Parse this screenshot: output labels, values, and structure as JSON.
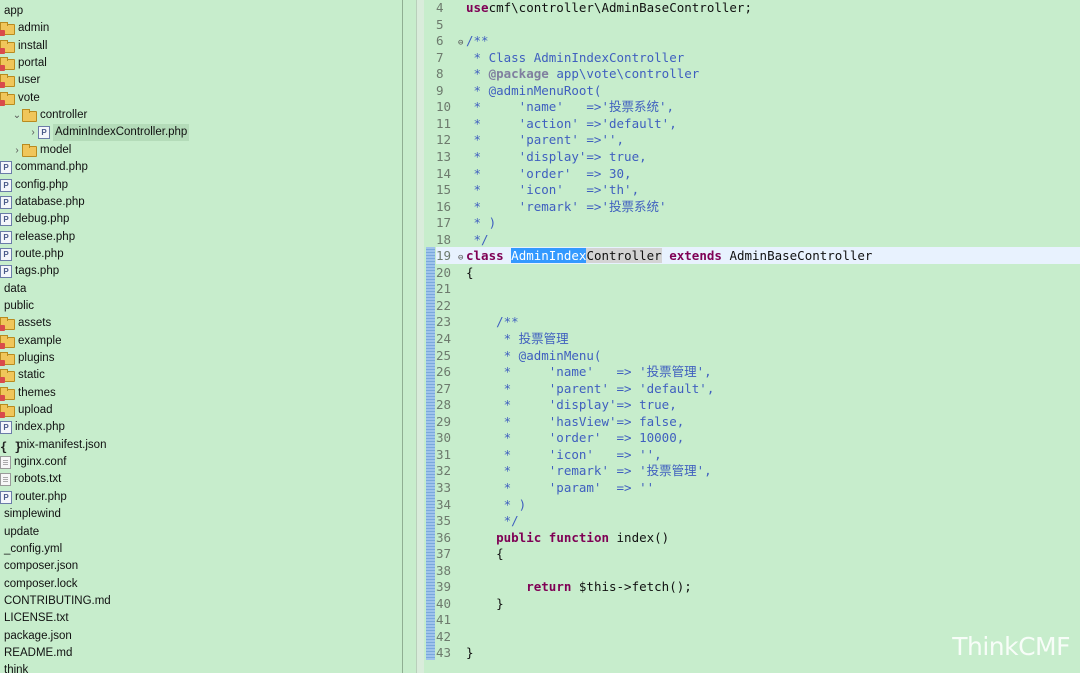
{
  "tree": [
    {
      "label": "app",
      "indent": 0,
      "icon": "none",
      "arrow": ""
    },
    {
      "label": "admin",
      "indent": 1,
      "icon": "package-folder-icon",
      "arrow": ""
    },
    {
      "label": "install",
      "indent": 1,
      "icon": "package-folder-icon",
      "arrow": ""
    },
    {
      "label": "portal",
      "indent": 1,
      "icon": "package-folder-icon",
      "arrow": ""
    },
    {
      "label": "user",
      "indent": 1,
      "icon": "package-folder-icon",
      "arrow": ""
    },
    {
      "label": "vote",
      "indent": 1,
      "icon": "package-folder-icon",
      "arrow": ""
    },
    {
      "label": "controller",
      "indent": 2,
      "icon": "folder-icon",
      "arrow": "v"
    },
    {
      "label": "AdminIndexController.php",
      "indent": 3,
      "icon": "php-file-icon",
      "arrow": ">",
      "selected": true
    },
    {
      "label": "model",
      "indent": 2,
      "icon": "folder-icon",
      "arrow": ">"
    },
    {
      "label": "command.php",
      "indent": 1,
      "icon": "php-file-icon",
      "arrow": ""
    },
    {
      "label": "config.php",
      "indent": 1,
      "icon": "php-file-icon",
      "arrow": ""
    },
    {
      "label": "database.php",
      "indent": 1,
      "icon": "php-file-icon",
      "arrow": ""
    },
    {
      "label": "debug.php",
      "indent": 1,
      "icon": "php-file-icon",
      "arrow": ""
    },
    {
      "label": "release.php",
      "indent": 1,
      "icon": "php-file-icon",
      "arrow": ""
    },
    {
      "label": "route.php",
      "indent": 1,
      "icon": "php-file-icon",
      "arrow": ""
    },
    {
      "label": "tags.php",
      "indent": 1,
      "icon": "php-file-icon",
      "arrow": ""
    },
    {
      "label": "data",
      "indent": 0,
      "icon": "none",
      "arrow": ""
    },
    {
      "label": "public",
      "indent": 0,
      "icon": "none",
      "arrow": ""
    },
    {
      "label": "assets",
      "indent": 1,
      "icon": "package-folder-icon",
      "arrow": ""
    },
    {
      "label": "example",
      "indent": 1,
      "icon": "package-folder-icon",
      "arrow": ""
    },
    {
      "label": "plugins",
      "indent": 1,
      "icon": "package-folder-icon",
      "arrow": ""
    },
    {
      "label": "static",
      "indent": 1,
      "icon": "package-folder-icon",
      "arrow": ""
    },
    {
      "label": "themes",
      "indent": 1,
      "icon": "package-folder-icon",
      "arrow": ""
    },
    {
      "label": "upload",
      "indent": 1,
      "icon": "package-folder-icon",
      "arrow": ""
    },
    {
      "label": "index.php",
      "indent": 1,
      "icon": "php-file-icon",
      "arrow": ""
    },
    {
      "label": "mix-manifest.json",
      "indent": 1,
      "icon": "json-file-icon",
      "arrow": ""
    },
    {
      "label": "nginx.conf",
      "indent": 1,
      "icon": "text-file-icon",
      "arrow": ""
    },
    {
      "label": "robots.txt",
      "indent": 1,
      "icon": "text-file-icon",
      "arrow": ""
    },
    {
      "label": "router.php",
      "indent": 1,
      "icon": "php-file-icon",
      "arrow": ""
    },
    {
      "label": "simplewind",
      "indent": 0,
      "icon": "none",
      "arrow": ""
    },
    {
      "label": "update",
      "indent": 0,
      "icon": "none",
      "arrow": ""
    },
    {
      "label": "_config.yml",
      "indent": 0,
      "icon": "none",
      "arrow": ""
    },
    {
      "label": "composer.json",
      "indent": 0,
      "icon": "none",
      "arrow": ""
    },
    {
      "label": "composer.lock",
      "indent": 0,
      "icon": "none",
      "arrow": ""
    },
    {
      "label": "CONTRIBUTING.md",
      "indent": 0,
      "icon": "none",
      "arrow": ""
    },
    {
      "label": "LICENSE.txt",
      "indent": 0,
      "icon": "none",
      "arrow": ""
    },
    {
      "label": "package.json",
      "indent": 0,
      "icon": "none",
      "arrow": ""
    },
    {
      "label": "README.md",
      "indent": 0,
      "icon": "none",
      "arrow": ""
    },
    {
      "label": "think",
      "indent": 0,
      "icon": "none",
      "arrow": ""
    }
  ],
  "code": [
    {
      "n": "4",
      "fold": "",
      "tokens": [
        [
          "k",
          "use"
        ],
        [
          "",
          "cmf\\controller\\AdminBaseController;"
        ]
      ]
    },
    {
      "n": "5",
      "fold": "",
      "tokens": []
    },
    {
      "n": "6",
      "fold": "⊖",
      "tokens": [
        [
          "c",
          "/**"
        ]
      ]
    },
    {
      "n": "7",
      "fold": "",
      "tokens": [
        [
          "c",
          " * Class AdminIndexController"
        ]
      ]
    },
    {
      "n": "8",
      "fold": "",
      "tokens": [
        [
          "c",
          " * "
        ],
        [
          "t",
          "@package"
        ],
        [
          "c",
          " app\\vote\\controller"
        ]
      ]
    },
    {
      "n": "9",
      "fold": "",
      "tokens": [
        [
          "c",
          " * @adminMenuRoot("
        ]
      ]
    },
    {
      "n": "10",
      "fold": "",
      "tokens": [
        [
          "c",
          " *     'name'   =>'投票系统',"
        ]
      ]
    },
    {
      "n": "11",
      "fold": "",
      "tokens": [
        [
          "c",
          " *     'action' =>'default',"
        ]
      ]
    },
    {
      "n": "12",
      "fold": "",
      "tokens": [
        [
          "c",
          " *     'parent' =>'',"
        ]
      ]
    },
    {
      "n": "13",
      "fold": "",
      "tokens": [
        [
          "c",
          " *     'display'=> true,"
        ]
      ]
    },
    {
      "n": "14",
      "fold": "",
      "tokens": [
        [
          "c",
          " *     'order'  => 30,"
        ]
      ]
    },
    {
      "n": "15",
      "fold": "",
      "tokens": [
        [
          "c",
          " *     'icon'   =>'th',"
        ]
      ]
    },
    {
      "n": "16",
      "fold": "",
      "tokens": [
        [
          "c",
          " *     'remark' =>'投票系统'"
        ]
      ]
    },
    {
      "n": "17",
      "fold": "",
      "tokens": [
        [
          "c",
          " * )"
        ]
      ]
    },
    {
      "n": "18",
      "fold": "",
      "tokens": [
        [
          "c",
          " */"
        ]
      ]
    },
    {
      "n": "19",
      "fold": "⊖",
      "current": true,
      "tokens": [
        [
          "k",
          "class"
        ],
        [
          "",
          " "
        ],
        [
          "hl",
          "AdminIndex"
        ],
        [
          "hl2",
          "Controller"
        ],
        [
          "",
          " "
        ],
        [
          "k",
          "extends"
        ],
        [
          "",
          " AdminBaseController"
        ]
      ]
    },
    {
      "n": "20",
      "fold": "",
      "tokens": [
        [
          "",
          "{"
        ]
      ]
    },
    {
      "n": "21",
      "fold": "",
      "tokens": []
    },
    {
      "n": "22",
      "fold": "",
      "tokens": []
    },
    {
      "n": "23",
      "fold": "",
      "tokens": [
        [
          "c",
          "    /**"
        ]
      ]
    },
    {
      "n": "24",
      "fold": "",
      "tokens": [
        [
          "c",
          "     * 投票管理"
        ]
      ]
    },
    {
      "n": "25",
      "fold": "",
      "tokens": [
        [
          "c",
          "     * @adminMenu("
        ]
      ]
    },
    {
      "n": "26",
      "fold": "",
      "tokens": [
        [
          "c",
          "     *     'name'   => '投票管理',"
        ]
      ]
    },
    {
      "n": "27",
      "fold": "",
      "tokens": [
        [
          "c",
          "     *     'parent' => 'default',"
        ]
      ]
    },
    {
      "n": "28",
      "fold": "",
      "tokens": [
        [
          "c",
          "     *     'display'=> true,"
        ]
      ]
    },
    {
      "n": "29",
      "fold": "",
      "tokens": [
        [
          "c",
          "     *     'hasView'=> false,"
        ]
      ]
    },
    {
      "n": "30",
      "fold": "",
      "tokens": [
        [
          "c",
          "     *     'order'  => 10000,"
        ]
      ]
    },
    {
      "n": "31",
      "fold": "",
      "tokens": [
        [
          "c",
          "     *     'icon'   => '',"
        ]
      ]
    },
    {
      "n": "32",
      "fold": "",
      "tokens": [
        [
          "c",
          "     *     'remark' => '投票管理',"
        ]
      ]
    },
    {
      "n": "33",
      "fold": "",
      "tokens": [
        [
          "c",
          "     *     'param'  => ''"
        ]
      ]
    },
    {
      "n": "34",
      "fold": "",
      "tokens": [
        [
          "c",
          "     * )"
        ]
      ]
    },
    {
      "n": "35",
      "fold": "",
      "tokens": [
        [
          "c",
          "     */"
        ]
      ]
    },
    {
      "n": "36",
      "fold": "",
      "tokens": [
        [
          "",
          "    "
        ],
        [
          "k",
          "public function"
        ],
        [
          "",
          " index()"
        ]
      ]
    },
    {
      "n": "37",
      "fold": "",
      "tokens": [
        [
          "",
          "    {"
        ]
      ]
    },
    {
      "n": "38",
      "fold": "",
      "tokens": []
    },
    {
      "n": "39",
      "fold": "",
      "tokens": [
        [
          "",
          "        "
        ],
        [
          "k",
          "return"
        ],
        [
          "",
          " $this->fetch();"
        ]
      ]
    },
    {
      "n": "40",
      "fold": "",
      "tokens": [
        [
          "",
          "    }"
        ]
      ]
    },
    {
      "n": "41",
      "fold": "",
      "tokens": []
    },
    {
      "n": "42",
      "fold": "",
      "tokens": []
    },
    {
      "n": "43",
      "fold": "",
      "tokens": [
        [
          "",
          "}"
        ]
      ]
    }
  ],
  "watermark": "ThinkCMF"
}
